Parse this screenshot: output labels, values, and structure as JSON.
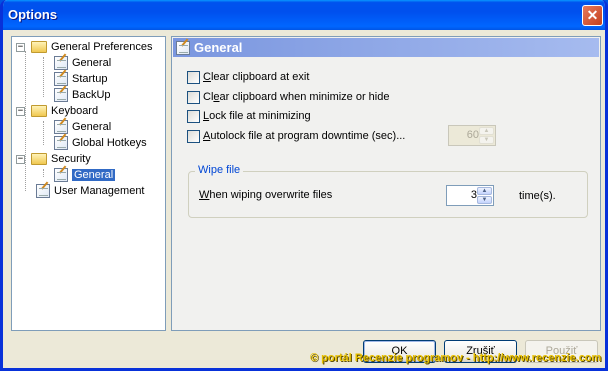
{
  "window": {
    "title": "Options",
    "close_glyph": "✕"
  },
  "tree": {
    "items": [
      {
        "label": "General Preferences",
        "level": 0,
        "type": "folder",
        "expanded": true
      },
      {
        "label": "General",
        "level": 1,
        "type": "page"
      },
      {
        "label": "Startup",
        "level": 1,
        "type": "page"
      },
      {
        "label": "BackUp",
        "level": 1,
        "type": "page"
      },
      {
        "label": "Keyboard",
        "level": 0,
        "type": "folder",
        "expanded": true
      },
      {
        "label": "General",
        "level": 1,
        "type": "page"
      },
      {
        "label": "Global Hotkeys",
        "level": 1,
        "type": "page"
      },
      {
        "label": "Security",
        "level": 0,
        "type": "folder",
        "expanded": true
      },
      {
        "label": "General",
        "level": 1,
        "type": "page",
        "selected": true
      },
      {
        "label": "User Management",
        "level": 0,
        "type": "page"
      }
    ],
    "expander_glyph": "−"
  },
  "panel": {
    "title": "General",
    "options": [
      {
        "mnemonic": "C",
        "rest": "lear clipboard at exit",
        "checked": false
      },
      {
        "pre": "Cl",
        "mnemonic": "e",
        "rest": "ar clipboard when minimize or hide",
        "checked": false
      },
      {
        "mnemonic": "L",
        "rest": "ock file at minimizing",
        "checked": false
      },
      {
        "mnemonic": "A",
        "rest": "utolock file at program downtime  (sec)...",
        "checked": false
      }
    ],
    "autolock_value": "60",
    "wipe": {
      "legend": "Wipe file",
      "label_mnemonic": "W",
      "label_rest": "hen wiping overwrite files",
      "value": "3",
      "unit": "time(s)."
    }
  },
  "buttons": {
    "ok": "OK",
    "cancel": "Zrušiť",
    "apply": "Použiť"
  },
  "watermark": "© portál Recenzie programov - http://www.recenzie.com",
  "spin_up_glyph": "▲",
  "spin_down_glyph": "▼"
}
